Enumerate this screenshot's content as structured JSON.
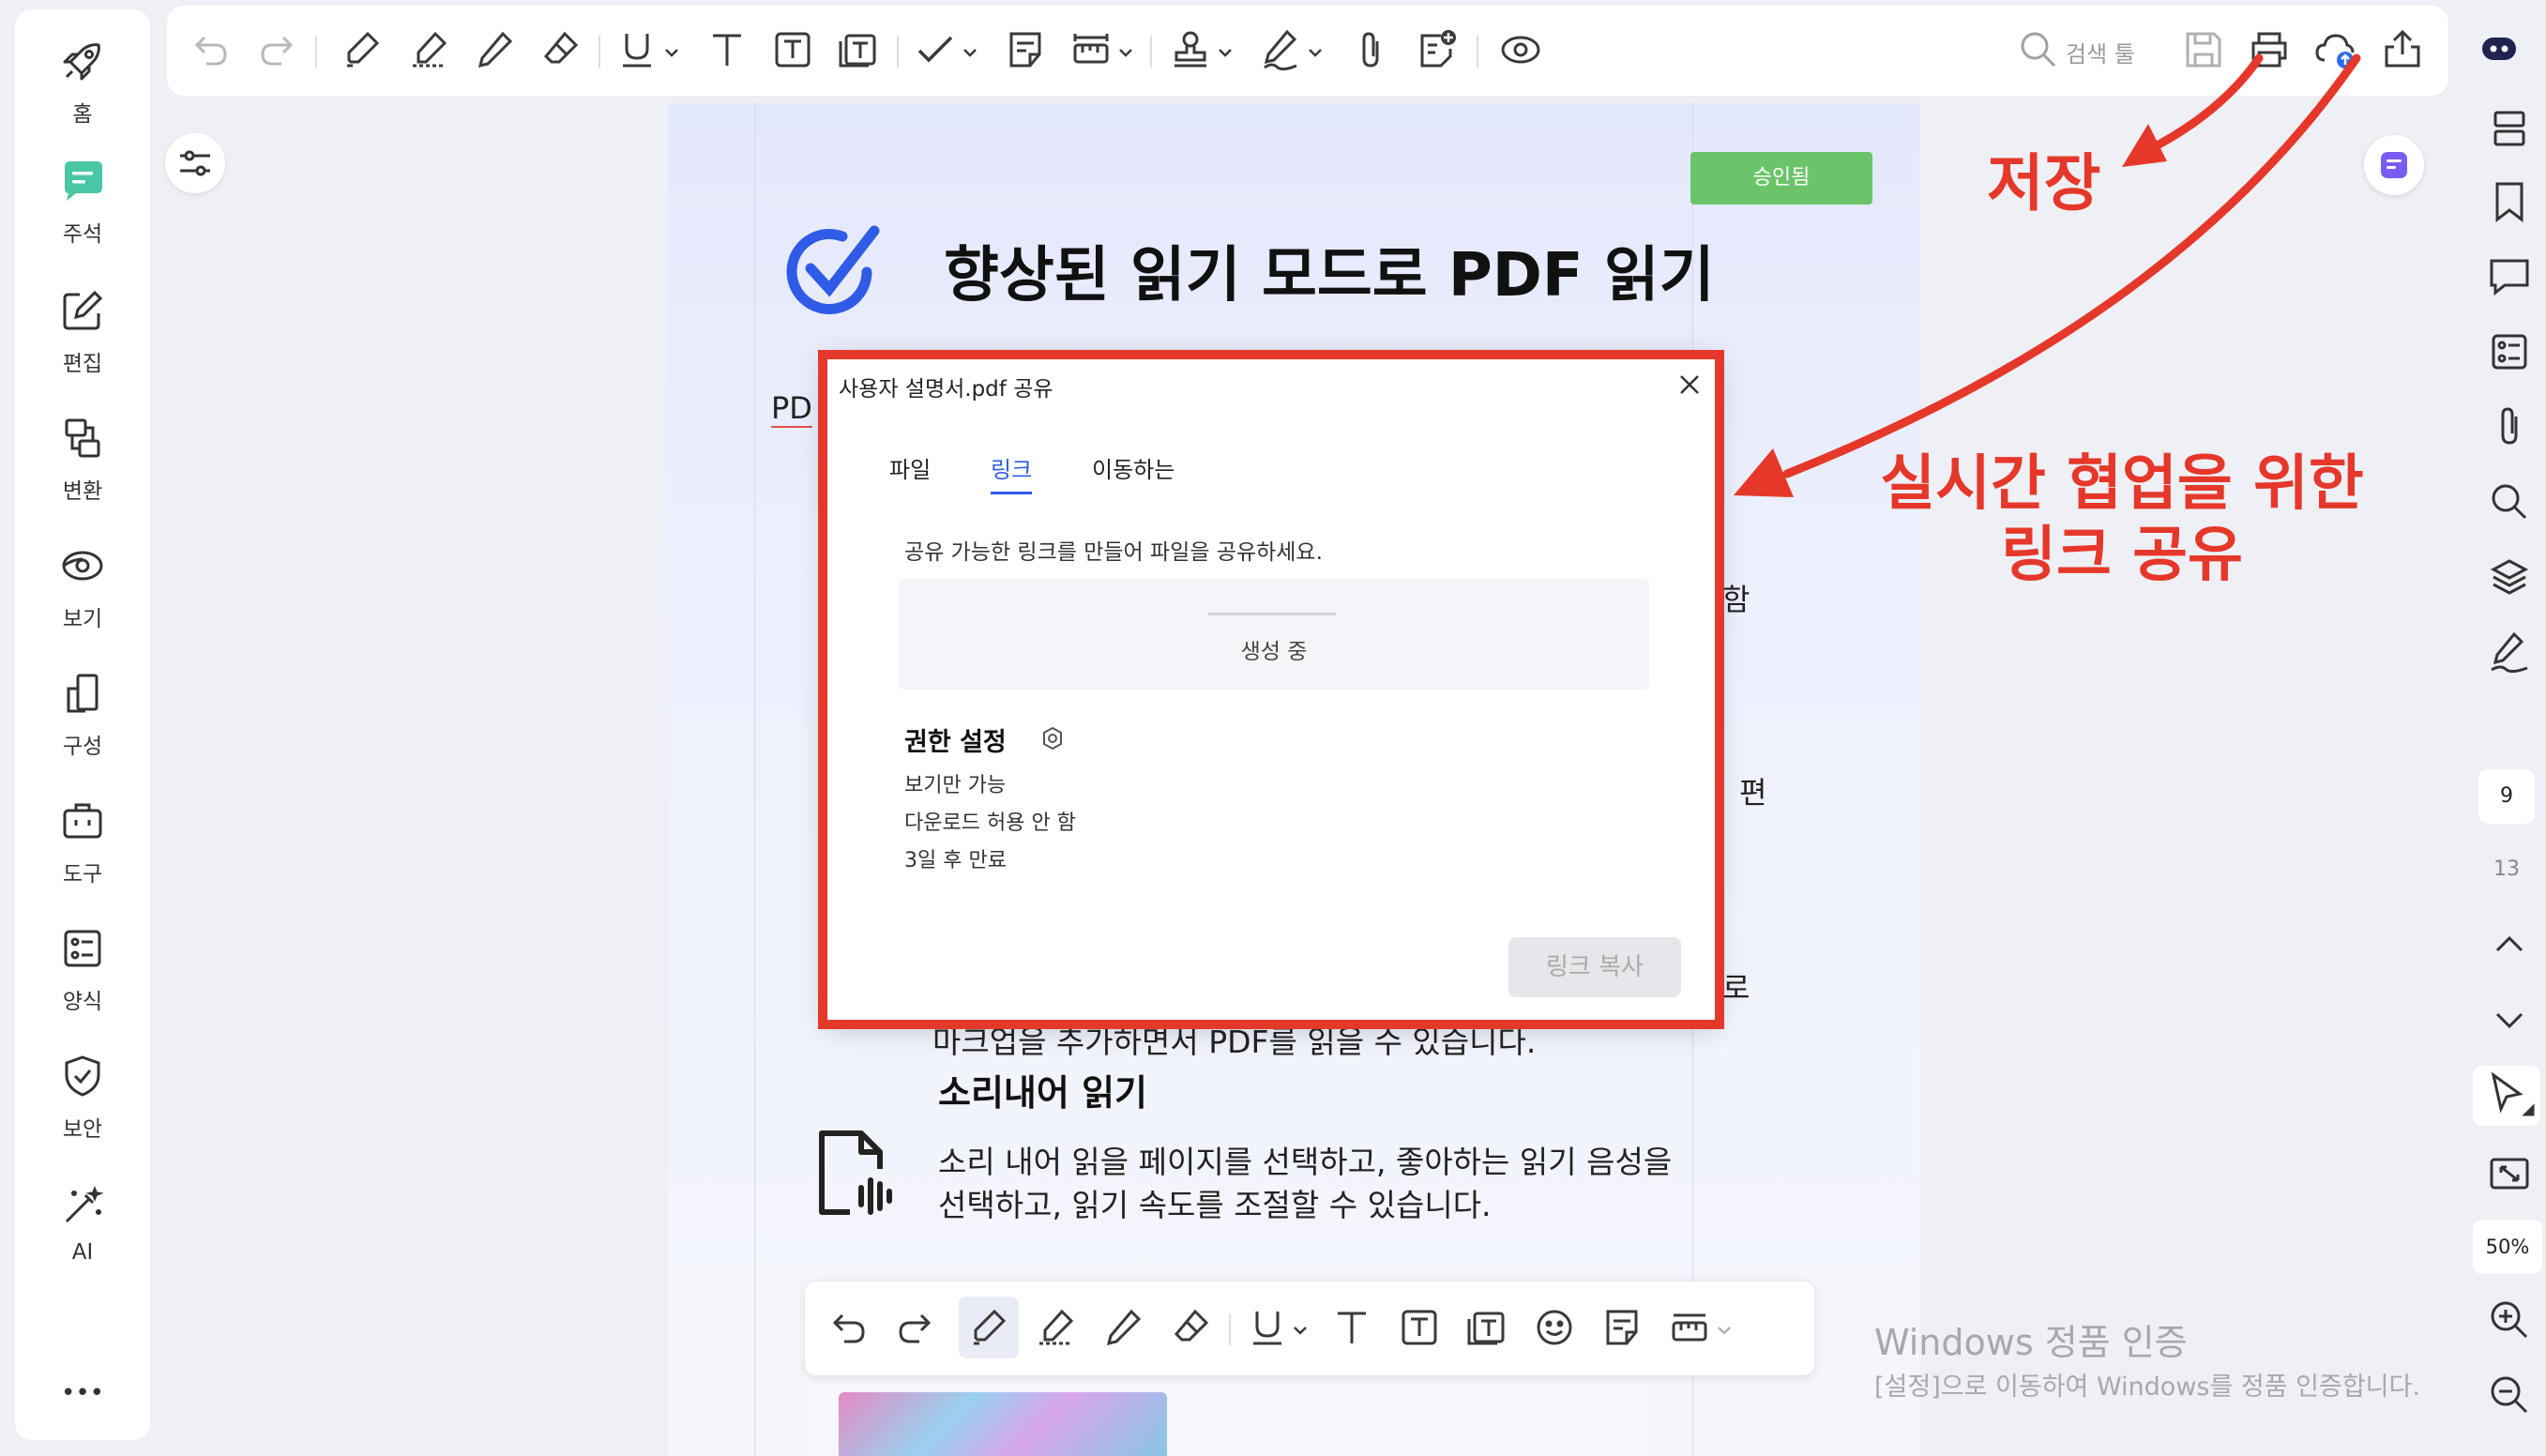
{
  "sidebar": {
    "items": [
      {
        "label": "홈",
        "icon": "rocket-icon"
      },
      {
        "label": "주석",
        "icon": "comment-icon"
      },
      {
        "label": "편집",
        "icon": "edit-icon"
      },
      {
        "label": "변환",
        "icon": "convert-icon"
      },
      {
        "label": "보기",
        "icon": "eye-icon"
      },
      {
        "label": "구성",
        "icon": "organize-icon"
      },
      {
        "label": "도구",
        "icon": "toolbox-icon"
      },
      {
        "label": "양식",
        "icon": "form-icon"
      },
      {
        "label": "보안",
        "icon": "shield-icon"
      },
      {
        "label": "AI",
        "icon": "magic-wand-icon"
      }
    ],
    "more": "•••"
  },
  "toolbar": {
    "search_placeholder": "검색 툴"
  },
  "document": {
    "approved_stamp": "승인됨",
    "heading": "향상된 읽기 모드로 PDF 읽기",
    "partial_left": "PD",
    "partial_right_1": "함",
    "partial_right_2": "편",
    "partial_right_3": "로",
    "partial_line": "마크업을 추가하면서 PDF를 읽을 수 있습니다.",
    "section_title": "소리내어 읽기",
    "section_body_line1": "소리 내어 읽을 페이지를 선택하고, 좋아하는 읽기 음성을",
    "section_body_line2": "선택하고, 읽기 속도를 조절할 수 있습니다."
  },
  "dialog": {
    "title": "사용자 설명서.pdf 공유",
    "tabs": [
      "파일",
      "링크",
      "이동하는"
    ],
    "active_tab": "링크",
    "description": "공유 가능한 링크를 만들어 파일을 공유하세요.",
    "status": "생성 중",
    "permission_title": "권한 설정",
    "permissions": [
      "보기만 가능",
      "다운로드 허용 안 함",
      "3일 후 만료"
    ],
    "copy_button": "링크 복사"
  },
  "right_rail": {
    "page_current": "9",
    "page_total": "13",
    "zoom": "50%"
  },
  "annotations": {
    "save_label": "저장",
    "share_label_line1": "실시간 협업을 위한",
    "share_label_line2": "링크 공유"
  },
  "watermark": {
    "line1": "Windows 정품 인증",
    "line2": "[설정]으로 이동하여 Windows를 정품 인증합니다."
  },
  "colors": {
    "annotation_red": "#e5382a",
    "accent_blue": "#2f5be6",
    "stamp_green": "#6cc46a"
  }
}
